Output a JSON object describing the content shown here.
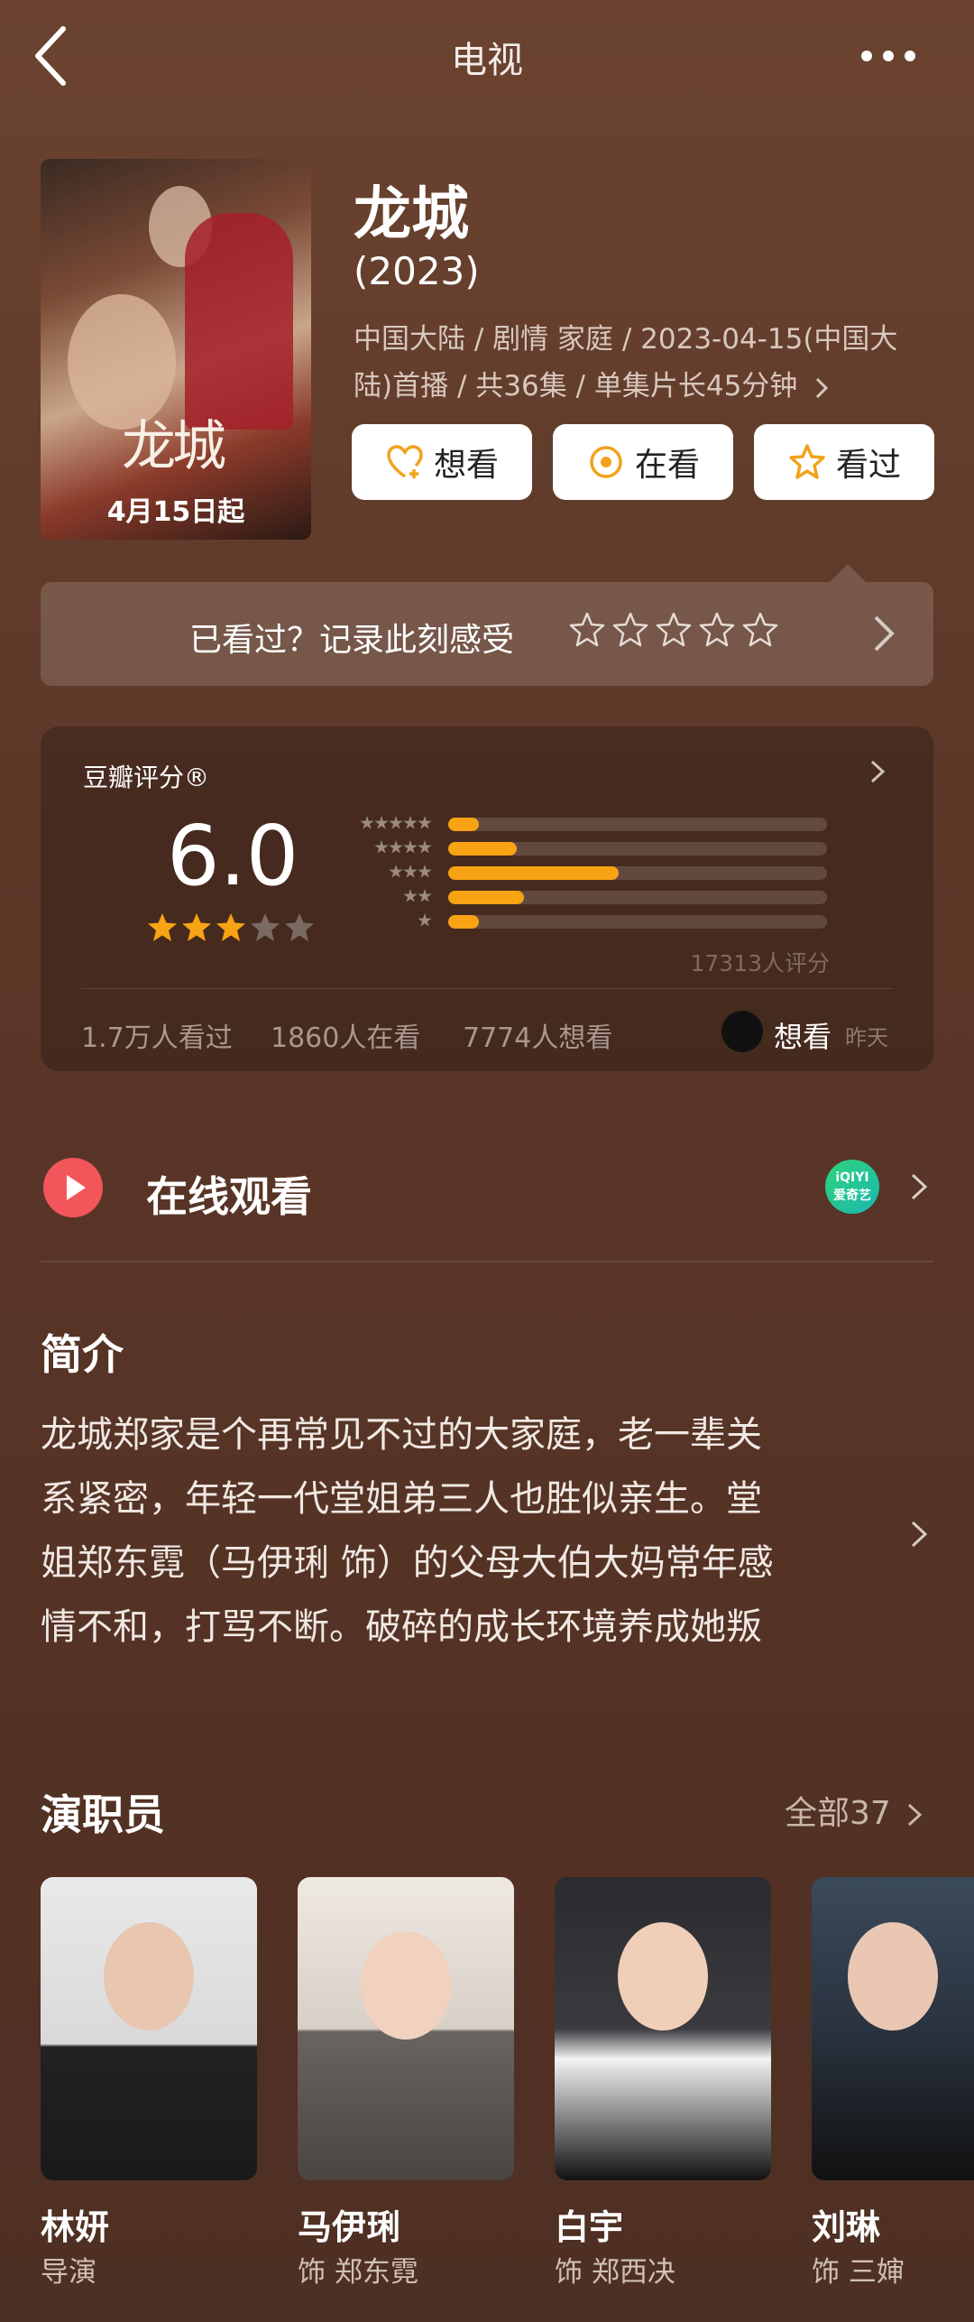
{
  "topbar": {
    "title": "电视"
  },
  "poster": {
    "art_text": "龙城",
    "date_text": "4月15日起"
  },
  "show": {
    "title": "龙城",
    "year": "(2023)",
    "meta_line1": "中国大陆 / 剧情 家庭 / 2023-04-15(中国大",
    "meta_line2": "陆)首播 / 共36集 / 单集片长45分钟"
  },
  "actions": [
    {
      "label": "想看",
      "icon": "heart-plus-icon"
    },
    {
      "label": "在看",
      "icon": "target-icon"
    },
    {
      "label": "看过",
      "icon": "star-outline-icon"
    }
  ],
  "rate_banner": {
    "text": "已看过？记录此刻感受"
  },
  "rating": {
    "label": "豆瓣评分®",
    "score": "6.0",
    "stars_filled": 3,
    "stars_total": 5,
    "distribution_percent": [
      8,
      18,
      45,
      20,
      8
    ],
    "count_text": "17313人评分",
    "watched": "1.7万人看过",
    "watching": "1860人在看",
    "want": "7774人想看",
    "friend_action": "想看",
    "friend_time": "昨天",
    "accent_color": "#f7a314"
  },
  "online": {
    "title": "在线观看",
    "provider_label": "iQIYI爱奇艺"
  },
  "synopsis": {
    "title": "简介",
    "lines": [
      "龙城郑家是个再常见不过的大家庭，老一辈关",
      "系紧密，年轻一代堂姐弟三人也胜似亲生。堂",
      "姐郑东霓（马伊琍 饰）的父母大伯大妈常年感",
      "情不和，打骂不断。破碎的成长环境养成她叛"
    ]
  },
  "cast": {
    "title": "演职员",
    "all_label": "全部37",
    "people": [
      {
        "name": "林妍",
        "role": "导演"
      },
      {
        "name": "马伊琍",
        "role": "饰 郑东霓"
      },
      {
        "name": "白宇",
        "role": "饰 郑西决"
      },
      {
        "name": "刘琳",
        "role": "饰 三婶"
      }
    ]
  }
}
